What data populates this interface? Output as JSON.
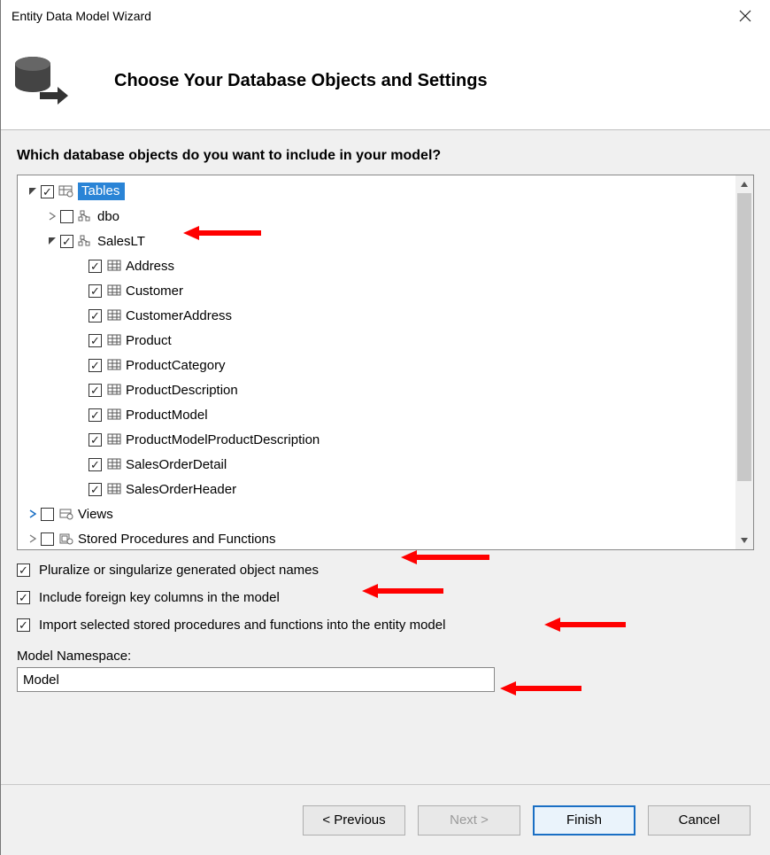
{
  "window": {
    "title": "Entity Data Model Wizard"
  },
  "banner": {
    "heading": "Choose Your Database Objects and Settings"
  },
  "question": "Which database objects do you want to include in your model?",
  "tree": {
    "tables_label": "Tables",
    "dbo_label": "dbo",
    "saleslt_label": "SalesLT",
    "saleslt_children": [
      "Address",
      "Customer",
      "CustomerAddress",
      "Product",
      "ProductCategory",
      "ProductDescription",
      "ProductModel",
      "ProductModelProductDescription",
      "SalesOrderDetail",
      "SalesOrderHeader"
    ],
    "views_label": "Views",
    "sprocs_label": "Stored Procedures and Functions"
  },
  "options": {
    "pluralize": "Pluralize or singularize generated object names",
    "fk": "Include foreign key columns in the model",
    "import_sprocs": "Import selected stored procedures and functions into the entity model"
  },
  "namespace": {
    "label": "Model Namespace:",
    "value": "Model"
  },
  "buttons": {
    "previous": "< Previous",
    "next": "Next >",
    "finish": "Finish",
    "cancel": "Cancel"
  }
}
